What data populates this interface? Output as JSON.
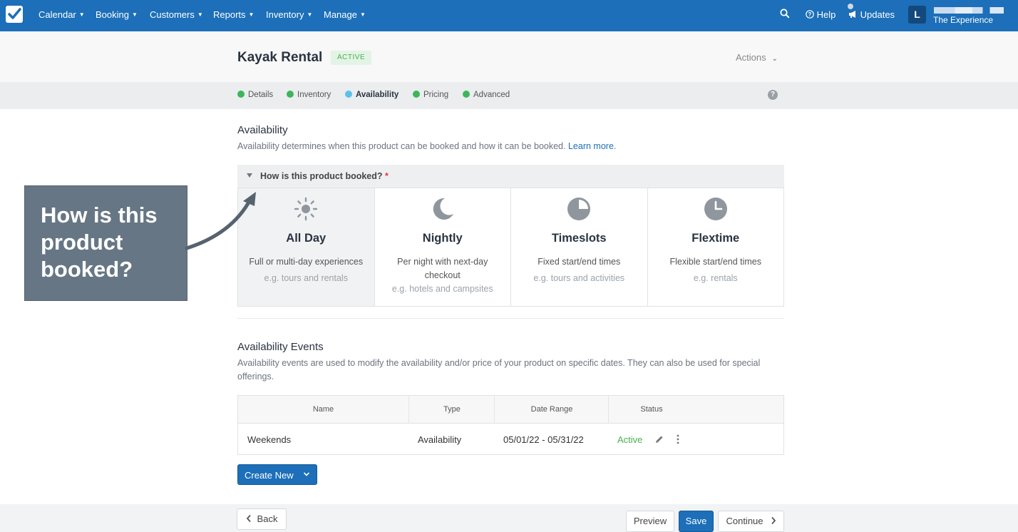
{
  "nav": {
    "items": [
      "Calendar",
      "Booking",
      "Customers",
      "Reports",
      "Inventory",
      "Manage"
    ],
    "help": "Help",
    "updates": "Updates",
    "avatar_initial": "L",
    "account_name": "The Experience"
  },
  "header": {
    "title": "Kayak Rental",
    "status_badge": "ACTIVE",
    "actions": "Actions"
  },
  "steps": [
    {
      "label": "Details",
      "state": "complete"
    },
    {
      "label": "Inventory",
      "state": "complete"
    },
    {
      "label": "Availability",
      "state": "active"
    },
    {
      "label": "Pricing",
      "state": "complete"
    },
    {
      "label": "Advanced",
      "state": "complete"
    }
  ],
  "help_q": "?",
  "availability": {
    "title": "Availability",
    "description": "Availability determines when this product can be booked and how it can be booked.",
    "learn_more": "Learn more",
    "question": "How is this product booked?",
    "required_mark": "*",
    "options": [
      {
        "name": "All Day",
        "desc": "Full or multi-day experiences",
        "example": "e.g. tours and rentals",
        "icon": "sun-icon",
        "selected": true
      },
      {
        "name": "Nightly",
        "desc": "Per night with next-day checkout",
        "example": "e.g. hotels and campsites",
        "icon": "moon-icon",
        "selected": false
      },
      {
        "name": "Timeslots",
        "desc": "Fixed start/end times",
        "example": "e.g. tours and activities",
        "icon": "pie-clock-icon",
        "selected": false
      },
      {
        "name": "Flextime",
        "desc": "Flexible start/end times",
        "example": "e.g. rentals",
        "icon": "clock-icon",
        "selected": false
      }
    ]
  },
  "events": {
    "title": "Availability Events",
    "description": "Availability events are used to modify the availability and/or price of your product on specific dates. They can also be used for special offerings.",
    "columns": [
      "Name",
      "Type",
      "Date Range",
      "Status"
    ],
    "rows": [
      {
        "name": "Weekends",
        "type": "Availability",
        "date_range": "05/01/22 - 05/31/22",
        "status": "Active"
      }
    ],
    "create_new": "Create New"
  },
  "footer": {
    "back": "Back",
    "preview": "Preview",
    "save": "Save",
    "continue": "Continue"
  },
  "callout": {
    "text": "How is this product booked?"
  },
  "colors": {
    "brand": "#1c6fb8",
    "success": "#3cb65b",
    "active_step": "#5cc1ea",
    "callout_bg": "#667684"
  }
}
